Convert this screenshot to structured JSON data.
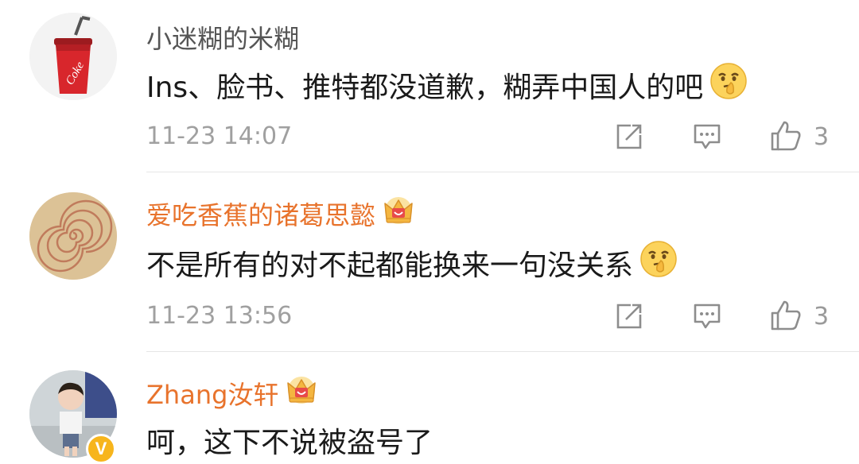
{
  "comments": [
    {
      "username": "小迷糊的米糊",
      "username_color": "#555555",
      "has_crown": false,
      "text": "Ins、脸书、推特都没道歉，糊弄中国人的吧",
      "time": "11-23 14:07",
      "likes": "3",
      "avatar": "cola-cup",
      "emoji": "shush-emoji"
    },
    {
      "username": "爱吃香蕉的诸葛思懿",
      "username_color": "#e8732c",
      "has_crown": true,
      "text": "不是所有的对不起都能换来一句没关系",
      "time": "11-23 13:56",
      "likes": "3",
      "avatar": "spiral",
      "emoji": "shush-emoji"
    },
    {
      "username": "Zhang汝轩",
      "username_color": "#e8732c",
      "has_crown": true,
      "text": "呵，这下不说被盗号了",
      "avatar": "child-photo",
      "verified_badge": "V"
    }
  ]
}
